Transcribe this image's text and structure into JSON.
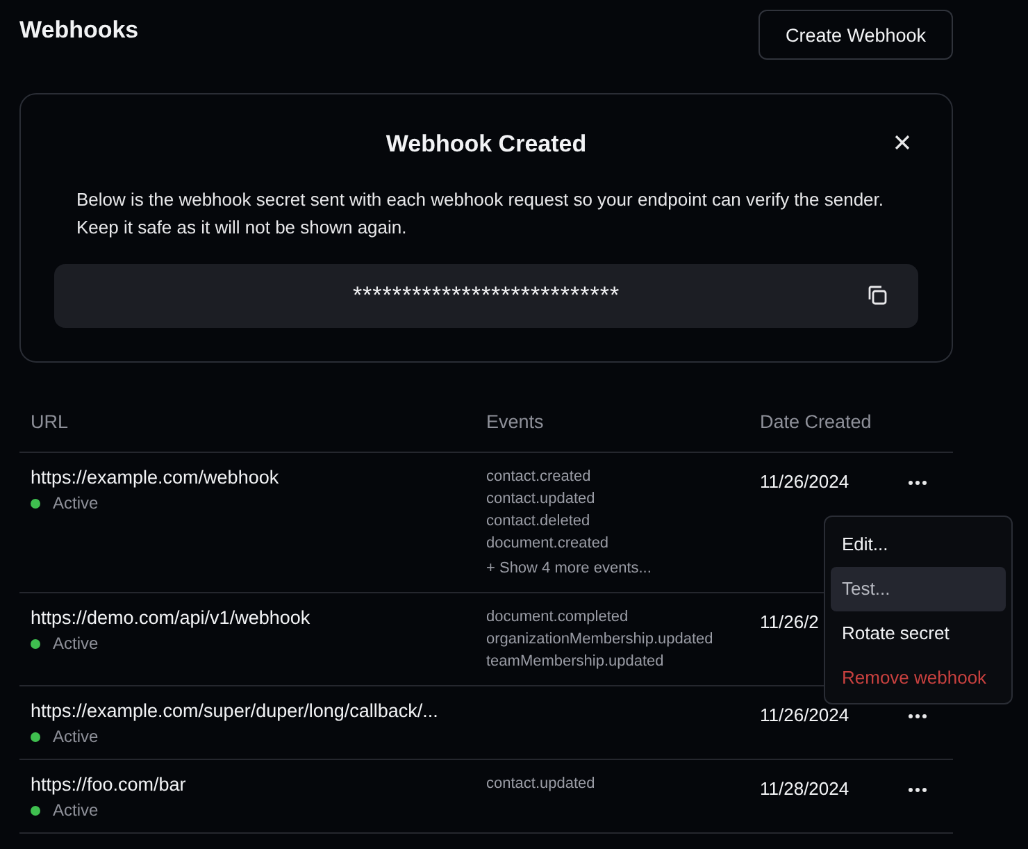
{
  "page": {
    "title": "Webhooks",
    "create_button": "Create Webhook"
  },
  "dialog": {
    "title": "Webhook Created",
    "message": "Below is the webhook secret sent with each webhook request so your endpoint can verify the sender. Keep it safe as it will not be shown again.",
    "secret": "***************************"
  },
  "table": {
    "columns": [
      "URL",
      "Events",
      "Date Created"
    ],
    "rows": [
      {
        "url": "https://example.com/webhook",
        "status": {
          "label": "Active",
          "color": "#3fbf4f"
        },
        "events": [
          "contact.created",
          "contact.updated",
          "contact.deleted",
          "document.created"
        ],
        "more_events": "+ Show 4 more events...",
        "date": "11/26/2024",
        "menu_open": true
      },
      {
        "url": "https://demo.com/api/v1/webhook",
        "status": {
          "label": "Active",
          "color": "#3fbf4f"
        },
        "events": [
          "document.completed",
          "organizationMembership.updated",
          "teamMembership.updated"
        ],
        "date": "11/26/2",
        "menu_open": false
      },
      {
        "url": "https://example.com/super/duper/long/callback/...",
        "status": {
          "label": "Active",
          "color": "#3fbf4f"
        },
        "events": [],
        "date": "11/26/2024",
        "menu_open": false
      },
      {
        "url": "https://foo.com/bar",
        "status": {
          "label": "Active",
          "color": "#3fbf4f"
        },
        "events": [
          "contact.updated"
        ],
        "date": "11/28/2024",
        "menu_open": false
      }
    ]
  },
  "menu": {
    "items": [
      {
        "label": "Edit...",
        "kind": "normal",
        "highlighted": false
      },
      {
        "label": "Test...",
        "kind": "normal",
        "highlighted": true
      },
      {
        "label": "Rotate secret",
        "kind": "normal",
        "highlighted": false
      },
      {
        "label": "Remove webhook",
        "kind": "danger",
        "highlighted": false
      }
    ]
  }
}
